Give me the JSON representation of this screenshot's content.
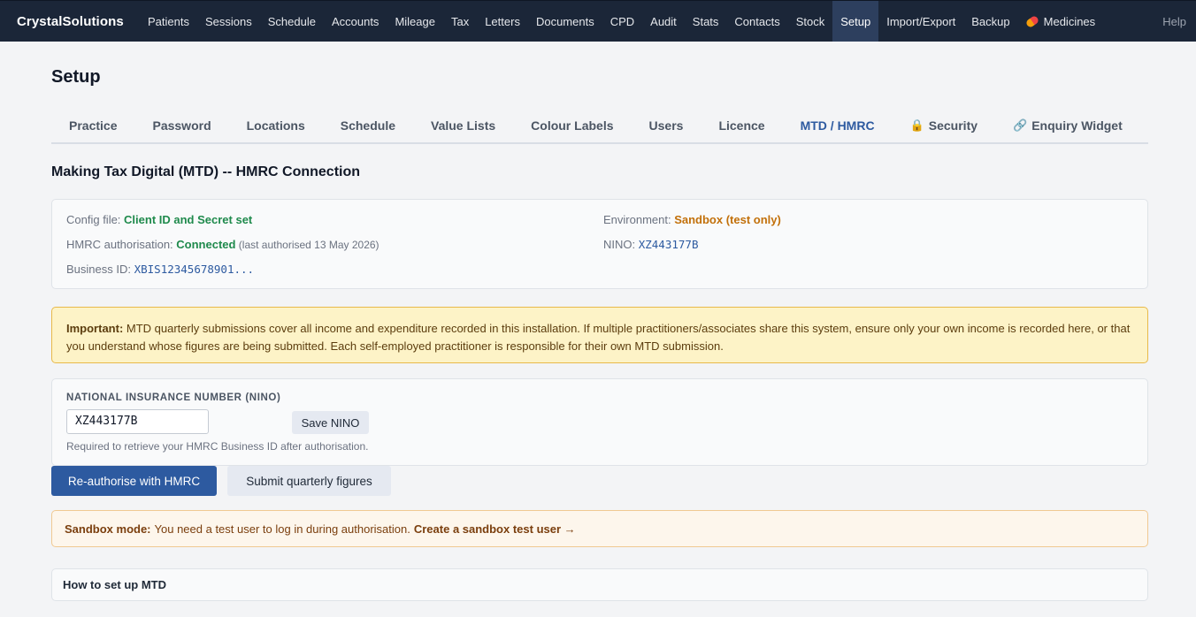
{
  "app": {
    "brand": "CrystalSolutions",
    "help": "Help"
  },
  "nav": [
    {
      "label": "Patients"
    },
    {
      "label": "Sessions"
    },
    {
      "label": "Schedule"
    },
    {
      "label": "Accounts"
    },
    {
      "label": "Mileage"
    },
    {
      "label": "Tax"
    },
    {
      "label": "Letters"
    },
    {
      "label": "Documents"
    },
    {
      "label": "CPD"
    },
    {
      "label": "Audit"
    },
    {
      "label": "Stats"
    },
    {
      "label": "Contacts"
    },
    {
      "label": "Stock"
    },
    {
      "label": "Setup",
      "active": true
    },
    {
      "label": "Import/Export"
    },
    {
      "label": "Backup"
    },
    {
      "label": "Medicines",
      "icon": "pill-icon"
    }
  ],
  "page": {
    "title": "Setup"
  },
  "tabs": [
    {
      "label": "Practice"
    },
    {
      "label": "Password"
    },
    {
      "label": "Locations"
    },
    {
      "label": "Schedule"
    },
    {
      "label": "Value Lists"
    },
    {
      "label": "Colour Labels"
    },
    {
      "label": "Users"
    },
    {
      "label": "Licence"
    },
    {
      "label": "MTD / HMRC",
      "active": true
    },
    {
      "label": "Security",
      "icon": "lock-icon"
    },
    {
      "label": "Enquiry Widget",
      "icon": "link-icon"
    }
  ],
  "section": {
    "heading": "Making Tax Digital (MTD) -- HMRC Connection"
  },
  "status": {
    "config_label": "Config file: ",
    "config_value": "Client ID and Secret set",
    "auth_label": "HMRC authorisation: ",
    "auth_value": "Connected",
    "auth_note": " (last authorised 13 May 2026)",
    "business_label": "Business ID: ",
    "business_value": "XBIS12345678901...",
    "env_label": "Environment: ",
    "env_value": "Sandbox (test only)",
    "nino_label": "NINO: ",
    "nino_value": "XZ443177B"
  },
  "warning": {
    "strong": "Important:",
    "text": " MTD quarterly submissions cover all income and expenditure recorded in this installation. If multiple practitioners/associates share this system, ensure only your own income is recorded here, or that you understand whose figures are being submitted. Each self-employed practitioner is responsible for their own MTD submission."
  },
  "nino_form": {
    "label": "NATIONAL INSURANCE NUMBER (NINO)",
    "value": "XZ443177B",
    "save_label": "Save NINO",
    "help": "Required to retrieve your HMRC Business ID after authorisation."
  },
  "actions": {
    "reauth_label": "Re-authorise with HMRC",
    "submit_label": "Submit quarterly figures"
  },
  "sandbox": {
    "strong": "Sandbox mode:",
    "text": "You need a test user to log in during authorisation.",
    "link": "Create a sandbox test user →"
  },
  "howto": {
    "label": "How to set up MTD"
  },
  "colors": {
    "nav_bg": "#1b2638",
    "nav_active": "#2d3f5e",
    "accent": "#2d5aa0",
    "success": "#1f8a4c",
    "warning_text": "#c2700a"
  }
}
